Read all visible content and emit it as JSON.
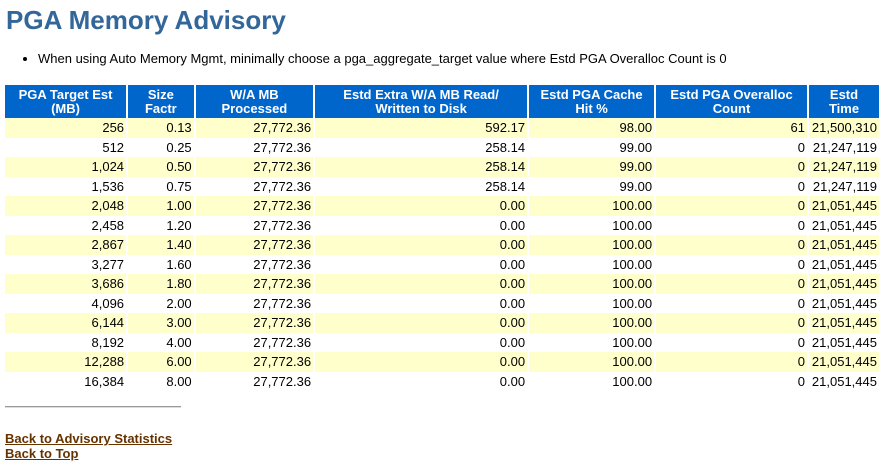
{
  "page": {
    "title": "PGA Memory Advisory",
    "note": "When using Auto Memory Mgmt, minimally choose a pga_aggregate_target value where Estd PGA Overalloc Count is 0"
  },
  "table": {
    "headers": [
      [
        "PGA Target Est",
        "(MB)"
      ],
      [
        "Size",
        "Factr"
      ],
      [
        "W/A MB",
        "Processed"
      ],
      [
        "Estd Extra W/A MB Read/",
        "Written to Disk"
      ],
      [
        "Estd PGA Cache",
        "Hit %"
      ],
      [
        "Estd PGA Overalloc",
        "Count"
      ],
      [
        "Estd",
        "Time"
      ]
    ],
    "rows": [
      [
        "256",
        "0.13",
        "27,772.36",
        "592.17",
        "98.00",
        "61",
        "21,500,310"
      ],
      [
        "512",
        "0.25",
        "27,772.36",
        "258.14",
        "99.00",
        "0",
        "21,247,119"
      ],
      [
        "1,024",
        "0.50",
        "27,772.36",
        "258.14",
        "99.00",
        "0",
        "21,247,119"
      ],
      [
        "1,536",
        "0.75",
        "27,772.36",
        "258.14",
        "99.00",
        "0",
        "21,247,119"
      ],
      [
        "2,048",
        "1.00",
        "27,772.36",
        "0.00",
        "100.00",
        "0",
        "21,051,445"
      ],
      [
        "2,458",
        "1.20",
        "27,772.36",
        "0.00",
        "100.00",
        "0",
        "21,051,445"
      ],
      [
        "2,867",
        "1.40",
        "27,772.36",
        "0.00",
        "100.00",
        "0",
        "21,051,445"
      ],
      [
        "3,277",
        "1.60",
        "27,772.36",
        "0.00",
        "100.00",
        "0",
        "21,051,445"
      ],
      [
        "3,686",
        "1.80",
        "27,772.36",
        "0.00",
        "100.00",
        "0",
        "21,051,445"
      ],
      [
        "4,096",
        "2.00",
        "27,772.36",
        "0.00",
        "100.00",
        "0",
        "21,051,445"
      ],
      [
        "6,144",
        "3.00",
        "27,772.36",
        "0.00",
        "100.00",
        "0",
        "21,051,445"
      ],
      [
        "8,192",
        "4.00",
        "27,772.36",
        "0.00",
        "100.00",
        "0",
        "21,051,445"
      ],
      [
        "12,288",
        "6.00",
        "27,772.36",
        "0.00",
        "100.00",
        "0",
        "21,051,445"
      ],
      [
        "16,384",
        "8.00",
        "27,772.36",
        "0.00",
        "100.00",
        "0",
        "21,051,445"
      ]
    ]
  },
  "links": {
    "back_to_advisory": "Back to Advisory Statistics",
    "back_to_top": "Back to Top"
  },
  "colors": {
    "title": "#336699",
    "header_bg": "#0066cc",
    "row_alt_bg": "#ffffcc",
    "link": "#663300"
  }
}
